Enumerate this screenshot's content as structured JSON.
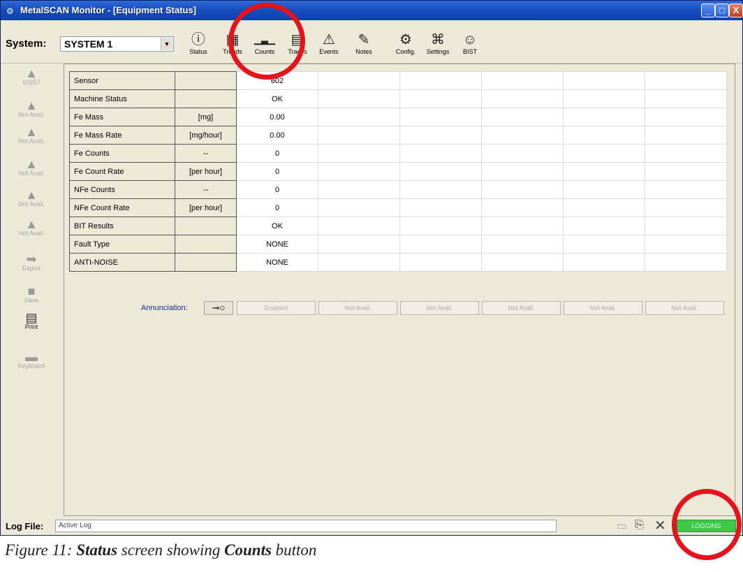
{
  "window": {
    "app_icon": "metalscan-app-icon",
    "title": "MetalSCAN Monitor - [Equipment Status]",
    "minimize": "_",
    "maximize": "□",
    "close": "X"
  },
  "system": {
    "label": "System:",
    "value": "SYSTEM 1"
  },
  "toolbar": [
    {
      "id": "status",
      "label": "Status",
      "icon": "info-icon",
      "glyph": "ⓘ"
    },
    {
      "id": "trends",
      "label": "Trends",
      "icon": "trends-icon",
      "glyph": "▦"
    },
    {
      "id": "counts",
      "label": "Counts",
      "icon": "bar-chart-icon",
      "glyph": "▁▃▁"
    },
    {
      "id": "traces",
      "label": "Traces",
      "icon": "traces-icon",
      "glyph": "▤"
    },
    {
      "id": "events",
      "label": "Events",
      "icon": "warning-icon",
      "glyph": "⚠"
    },
    {
      "id": "notes",
      "label": "Notes",
      "icon": "notepad-icon",
      "glyph": "✎"
    },
    {
      "id": "config",
      "label": "Config.",
      "icon": "config-icon",
      "glyph": "⚙"
    },
    {
      "id": "settings",
      "label": "Settings",
      "icon": "settings-icon",
      "glyph": "⌘"
    },
    {
      "id": "bist",
      "label": "BIST",
      "icon": "bist-icon",
      "glyph": "☺"
    }
  ],
  "sidebar": [
    {
      "label": "60257",
      "icon": "sensor-icon"
    },
    {
      "label": "Not Avail.",
      "icon": "sensor-icon"
    },
    {
      "label": "Not Avail.",
      "icon": "sensor-icon"
    },
    {
      "label": "Not Avail.",
      "icon": "sensor-icon"
    },
    {
      "label": "Not Avail.",
      "icon": "sensor-icon"
    },
    {
      "label": "Not Avail.",
      "icon": "sensor-icon"
    },
    {
      "label": "Export",
      "icon": "export-arrow-icon"
    },
    {
      "label": "Save",
      "icon": "save-icon"
    },
    {
      "label": "Print",
      "icon": "printer-icon"
    },
    {
      "label": "Keyboard",
      "icon": "keyboard-icon"
    }
  ],
  "table": {
    "rows": [
      {
        "name": "Sensor",
        "unit": "",
        "value": "602"
      },
      {
        "name": "Machine Status",
        "unit": "",
        "value": "OK"
      },
      {
        "name": "Fe Mass",
        "unit": "[mg]",
        "value": "0.00"
      },
      {
        "name": "Fe Mass Rate",
        "unit": "[mg/hour]",
        "value": "0.00"
      },
      {
        "name": "Fe Counts",
        "unit": "--",
        "value": "0"
      },
      {
        "name": "Fe Count Rate",
        "unit": "[per hour]",
        "value": "0"
      },
      {
        "name": "NFe Counts",
        "unit": "--",
        "value": "0"
      },
      {
        "name": "NFe Count Rate",
        "unit": "[per hour]",
        "value": "0"
      },
      {
        "name": "BIT Results",
        "unit": "",
        "value": "OK"
      },
      {
        "name": "Fault Type",
        "unit": "",
        "value": "NONE"
      },
      {
        "name": "ANTI-NOISE",
        "unit": "",
        "value": "NONE"
      }
    ]
  },
  "annunciation": {
    "label": "Annunciation:",
    "key_icon": "key-icon",
    "buttons": [
      "Enabled",
      "Not Avail.",
      "Not Avail.",
      "Not Avail.",
      "Not Avail.",
      "Not Avail."
    ]
  },
  "statusbar": {
    "log_label": "Log File:",
    "log_value": "Active Log",
    "logging": "LOGGING",
    "icons": [
      "folder-icon",
      "copy-icon",
      "close-icon"
    ]
  },
  "annotations": {
    "highlight_color": "#e3141c"
  },
  "caption": {
    "prefix": "Figure 11: ",
    "bold1": "Status",
    "middle": " screen showing ",
    "bold2": "Counts",
    "suffix": " button"
  }
}
